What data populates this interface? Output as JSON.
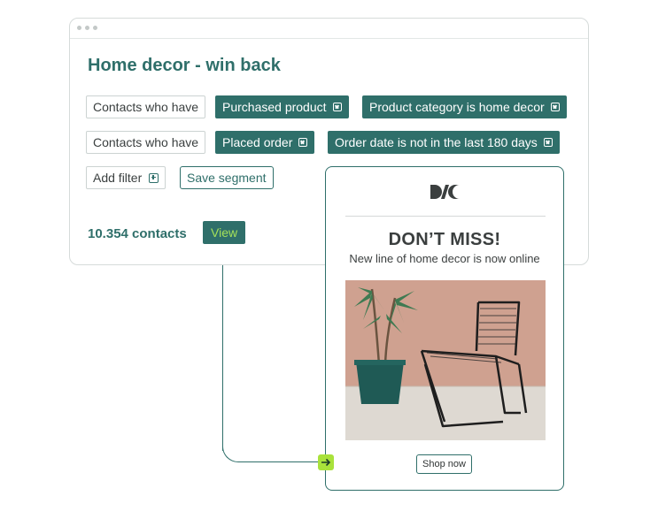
{
  "segment": {
    "title": "Home decor - win back",
    "rows": [
      {
        "prefix": "Contacts who have",
        "filters": [
          "Purchased product",
          "Product category is home decor"
        ]
      },
      {
        "prefix": "Contacts who have",
        "filters": [
          "Placed order",
          "Order date is not in the last 180 days"
        ]
      }
    ],
    "add_filter_label": "Add filter",
    "save_segment_label": "Save segment",
    "contacts_count": "10.354 contacts",
    "view_label": "View"
  },
  "email": {
    "headline": "DON’T MISS!",
    "subline": "New line of home decor is now online",
    "shop_label": "Shop now"
  },
  "colors": {
    "brand": "#2f6f6a",
    "accent": "#a9e23b",
    "view_text": "#a4e05a"
  },
  "icons": [
    "remove-filter-icon",
    "add-filter-icon",
    "arrow-right-icon",
    "brand-logo"
  ]
}
